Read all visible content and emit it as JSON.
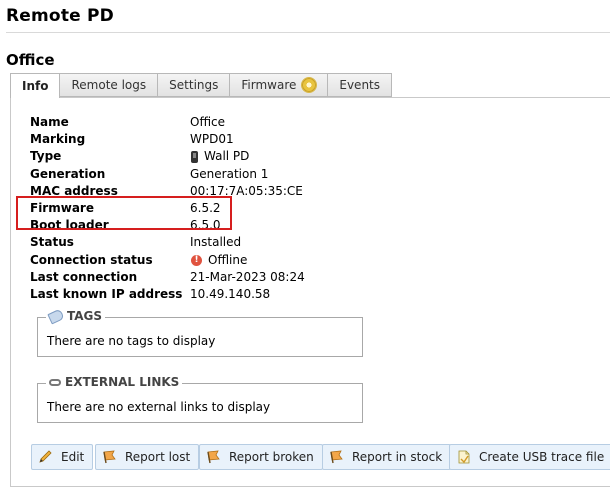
{
  "page": {
    "title": "Remote PD",
    "section_title": "Office"
  },
  "tabs": [
    {
      "label": "Info",
      "active": true
    },
    {
      "label": "Remote logs",
      "active": false
    },
    {
      "label": "Settings",
      "active": false
    },
    {
      "label": "Firmware",
      "active": false,
      "icon": "gear-icon"
    },
    {
      "label": "Events",
      "active": false
    }
  ],
  "info": [
    {
      "label": "Name",
      "value": "Office"
    },
    {
      "label": "Marking",
      "value": "WPD01"
    },
    {
      "label": "Type",
      "value": "Wall PD",
      "icon": "phone-icon"
    },
    {
      "label": "Generation",
      "value": "Generation 1"
    },
    {
      "label": "MAC address",
      "value": "00:17:7A:05:35:CE"
    },
    {
      "label": "Firmware",
      "value": "6.5.2"
    },
    {
      "label": "Boot loader",
      "value": "6.5.0"
    },
    {
      "label": "Status",
      "value": "Installed"
    },
    {
      "label": "Connection status",
      "value": "Offline",
      "icon": "offline-icon"
    },
    {
      "label": "Last connection",
      "value": "21-Mar-2023 08:24"
    },
    {
      "label": "Last known IP address",
      "value": "10.49.140.58"
    }
  ],
  "tags": {
    "legend": "TAGS",
    "empty_text": "There are no tags to display"
  },
  "external_links": {
    "legend": "EXTERNAL LINKS",
    "empty_text": "There are no external links to display"
  },
  "actions": [
    {
      "label": "Edit",
      "icon": "pencil-icon"
    },
    {
      "label": "Report lost",
      "icon": "flag-icon"
    },
    {
      "label": "Report broken",
      "icon": "flag-icon"
    },
    {
      "label": "Report in stock",
      "icon": "flag-icon"
    },
    {
      "label": "Create USB trace file",
      "icon": "document-icon"
    }
  ],
  "colors": {
    "highlight": "#d61e1e",
    "button_bg": "#e9f2fb",
    "offline": "#e0533f"
  }
}
